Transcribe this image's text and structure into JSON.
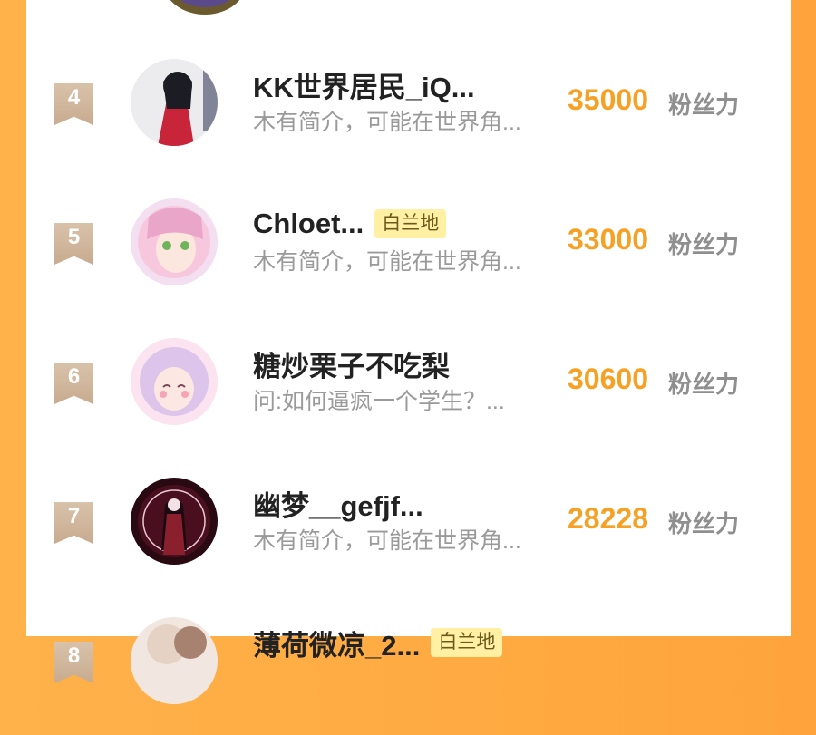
{
  "ranking": [
    {
      "rank": "4",
      "name": "KK世界居民_iQ...",
      "badge": "",
      "bio": "木有简介，可能在世界角...",
      "score": "35000",
      "unit": "粉丝力"
    },
    {
      "rank": "5",
      "name": "Chloet...",
      "badge": "白兰地",
      "bio": "木有简介，可能在世界角...",
      "score": "33000",
      "unit": "粉丝力"
    },
    {
      "rank": "6",
      "name": "糖炒栗子不吃梨",
      "badge": "",
      "bio": "问:如何逼疯一个学生？...",
      "score": "30600",
      "unit": "粉丝力"
    },
    {
      "rank": "7",
      "name": "幽梦__gefjf...",
      "badge": "",
      "bio": "木有简介，可能在世界角...",
      "score": "28228",
      "unit": "粉丝力"
    },
    {
      "rank": "8",
      "name": "薄荷微凉_2...",
      "badge": "白兰地",
      "bio": "",
      "score": "",
      "unit": ""
    }
  ],
  "colors": {
    "background": "#ffa43c",
    "score": "#f6a024",
    "badge_bg": "#fff0a3",
    "rank_badge": "#cbb096"
  }
}
